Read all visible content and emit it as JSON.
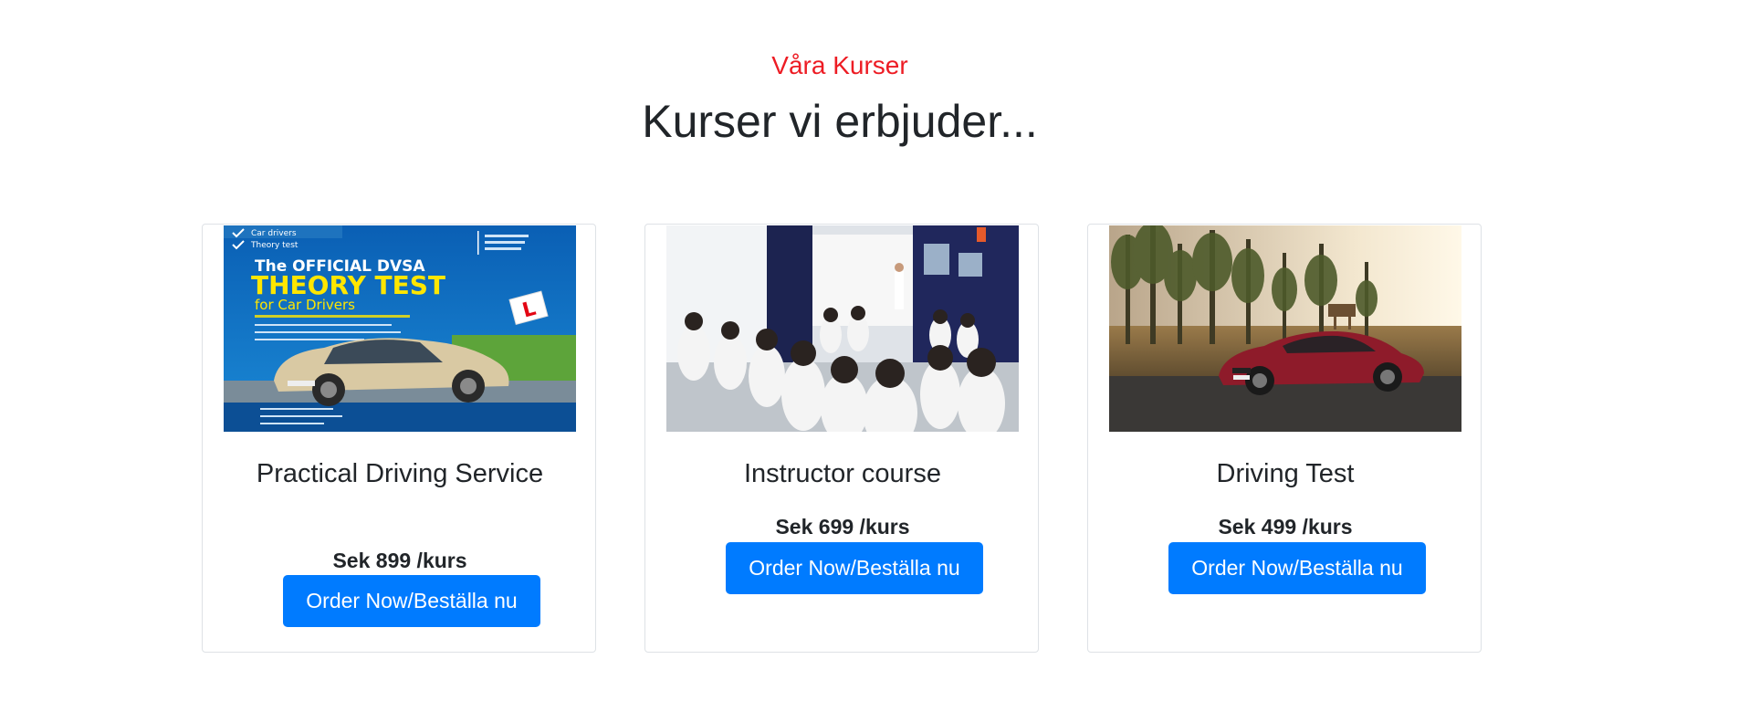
{
  "section": {
    "eyebrow": "Våra Kurser",
    "heading": "Kurser vi erbjuder..."
  },
  "courses": [
    {
      "title": "Practical Driving Service",
      "price": "Sek 899 /kurs",
      "button_label": "Order Now/Beställa nu",
      "image": {
        "tag_1": "Car drivers",
        "tag_2": "Theory test",
        "line_1": "The OFFICIAL DVSA",
        "line_2": "THEORY TEST",
        "line_3": "for Car Drivers",
        "badge": "L"
      }
    },
    {
      "title": "Instructor course",
      "price": "Sek 699 /kurs",
      "button_label": "Order Now/Beställa nu"
    },
    {
      "title": "Driving Test",
      "price": "Sek 499 /kurs",
      "button_label": "Order Now/Beställa nu"
    }
  ],
  "colors": {
    "accent_red": "#ed1c24",
    "button_blue": "#007bff",
    "text_dark": "#212529",
    "card_border": "#dee2e6"
  }
}
